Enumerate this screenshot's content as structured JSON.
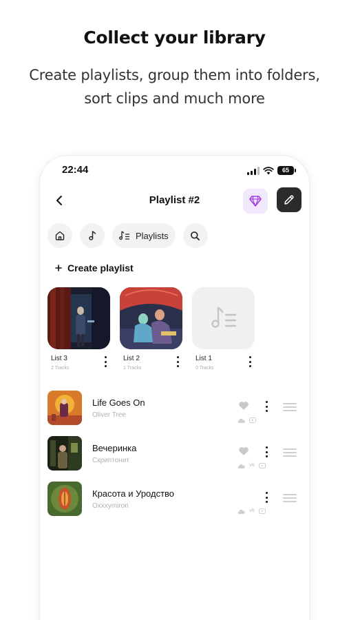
{
  "promo": {
    "title": "Collect your library",
    "subtitle_line1": "Create playlists, group them into folders,",
    "subtitle_line2": "sort clips and much more"
  },
  "status_bar": {
    "time": "22:44",
    "battery": "65"
  },
  "header": {
    "title": "Playlist #2",
    "premium_icon": "gem-icon",
    "edit_icon": "pencil-icon",
    "back_icon": "chevron-left-icon"
  },
  "chips": [
    {
      "icon": "home-icon"
    },
    {
      "icon": "music-note-icon"
    },
    {
      "icon": "playlist-icon",
      "label": "Playlists"
    },
    {
      "icon": "search-icon"
    }
  ],
  "create_playlist": {
    "label": "Create playlist"
  },
  "playlists": [
    {
      "name": "List 3",
      "count": "2 Tracks"
    },
    {
      "name": "List 2",
      "count": "1 Tracks"
    },
    {
      "name": "List 1",
      "count": "0 Tracks"
    }
  ],
  "tracks": [
    {
      "title": "Life Goes On",
      "artist": "Oliver Tree",
      "liked": true
    },
    {
      "title": "Вечеринка",
      "artist": "Скриптонит",
      "liked": true
    },
    {
      "title": "Красота и Уродство",
      "artist": "Oxxxymiron",
      "liked": false
    }
  ],
  "colors": {
    "accent_purple": "#a23fe0",
    "gem_bg": "#f1e8fd",
    "edit_bg": "#2b2b2b",
    "chip_bg": "#f2f2f2",
    "muted": "#b1b1b1"
  }
}
